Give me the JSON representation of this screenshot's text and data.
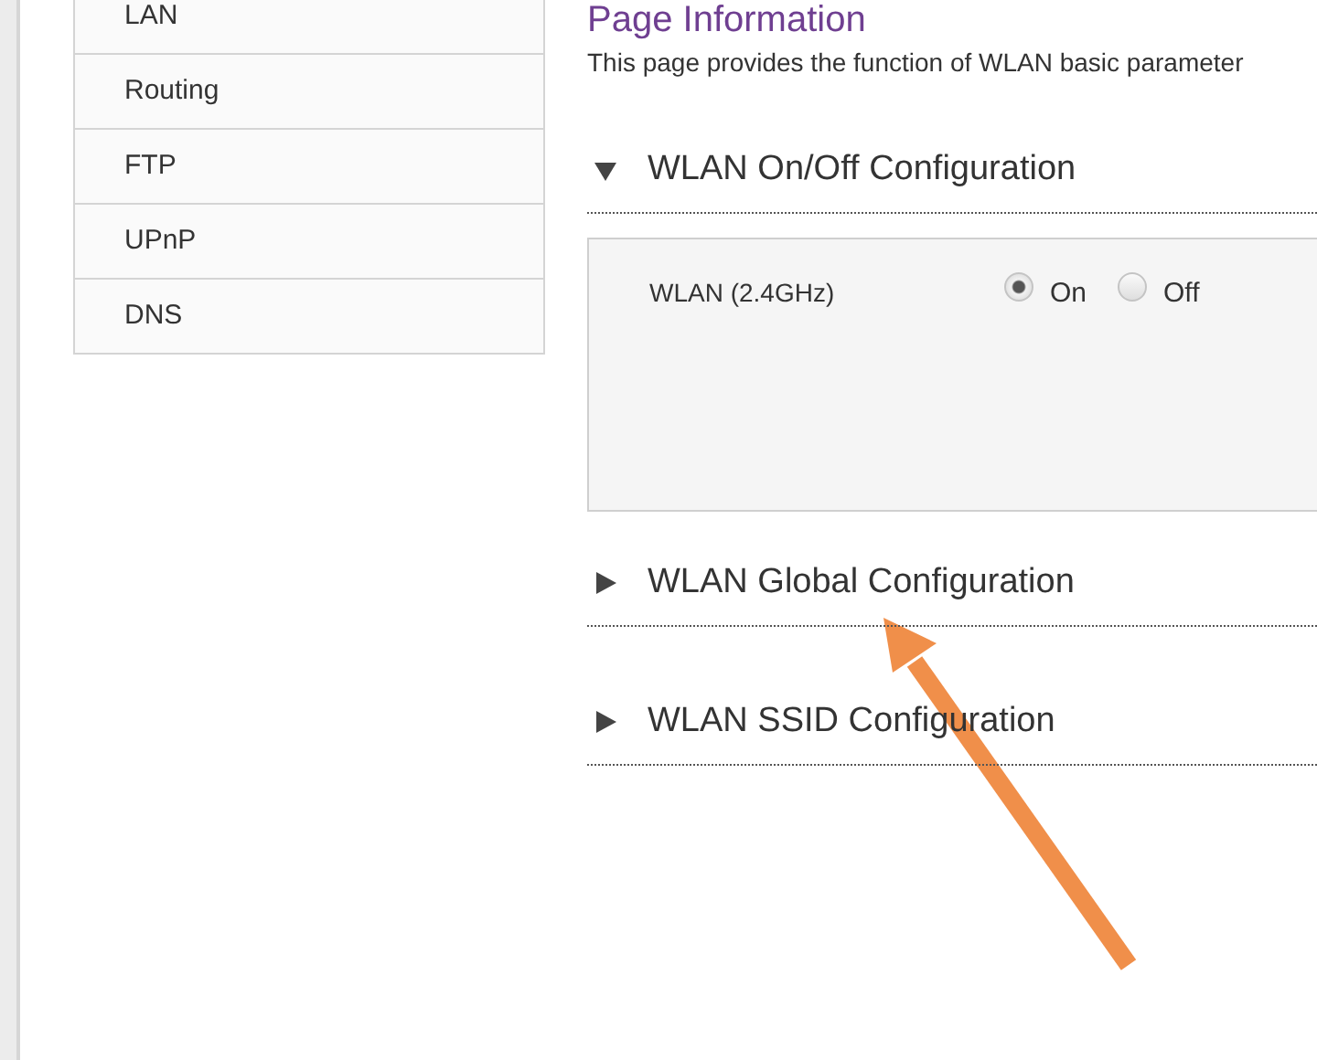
{
  "sidebar": {
    "items": [
      {
        "label": "LAN"
      },
      {
        "label": "Routing"
      },
      {
        "label": "FTP"
      },
      {
        "label": "UPnP"
      },
      {
        "label": "DNS"
      }
    ]
  },
  "page": {
    "title": "Page Information",
    "description": "This page provides the function of WLAN basic parameter"
  },
  "sections": [
    {
      "title": "WLAN On/Off Configuration",
      "expanded": true,
      "fields": [
        {
          "label": "WLAN (2.4GHz)",
          "options": [
            {
              "label": "On",
              "selected": true
            },
            {
              "label": "Off",
              "selected": false
            }
          ]
        }
      ]
    },
    {
      "title": "WLAN Global Configuration",
      "expanded": false
    },
    {
      "title": "WLAN SSID Configuration",
      "expanded": false
    }
  ]
}
